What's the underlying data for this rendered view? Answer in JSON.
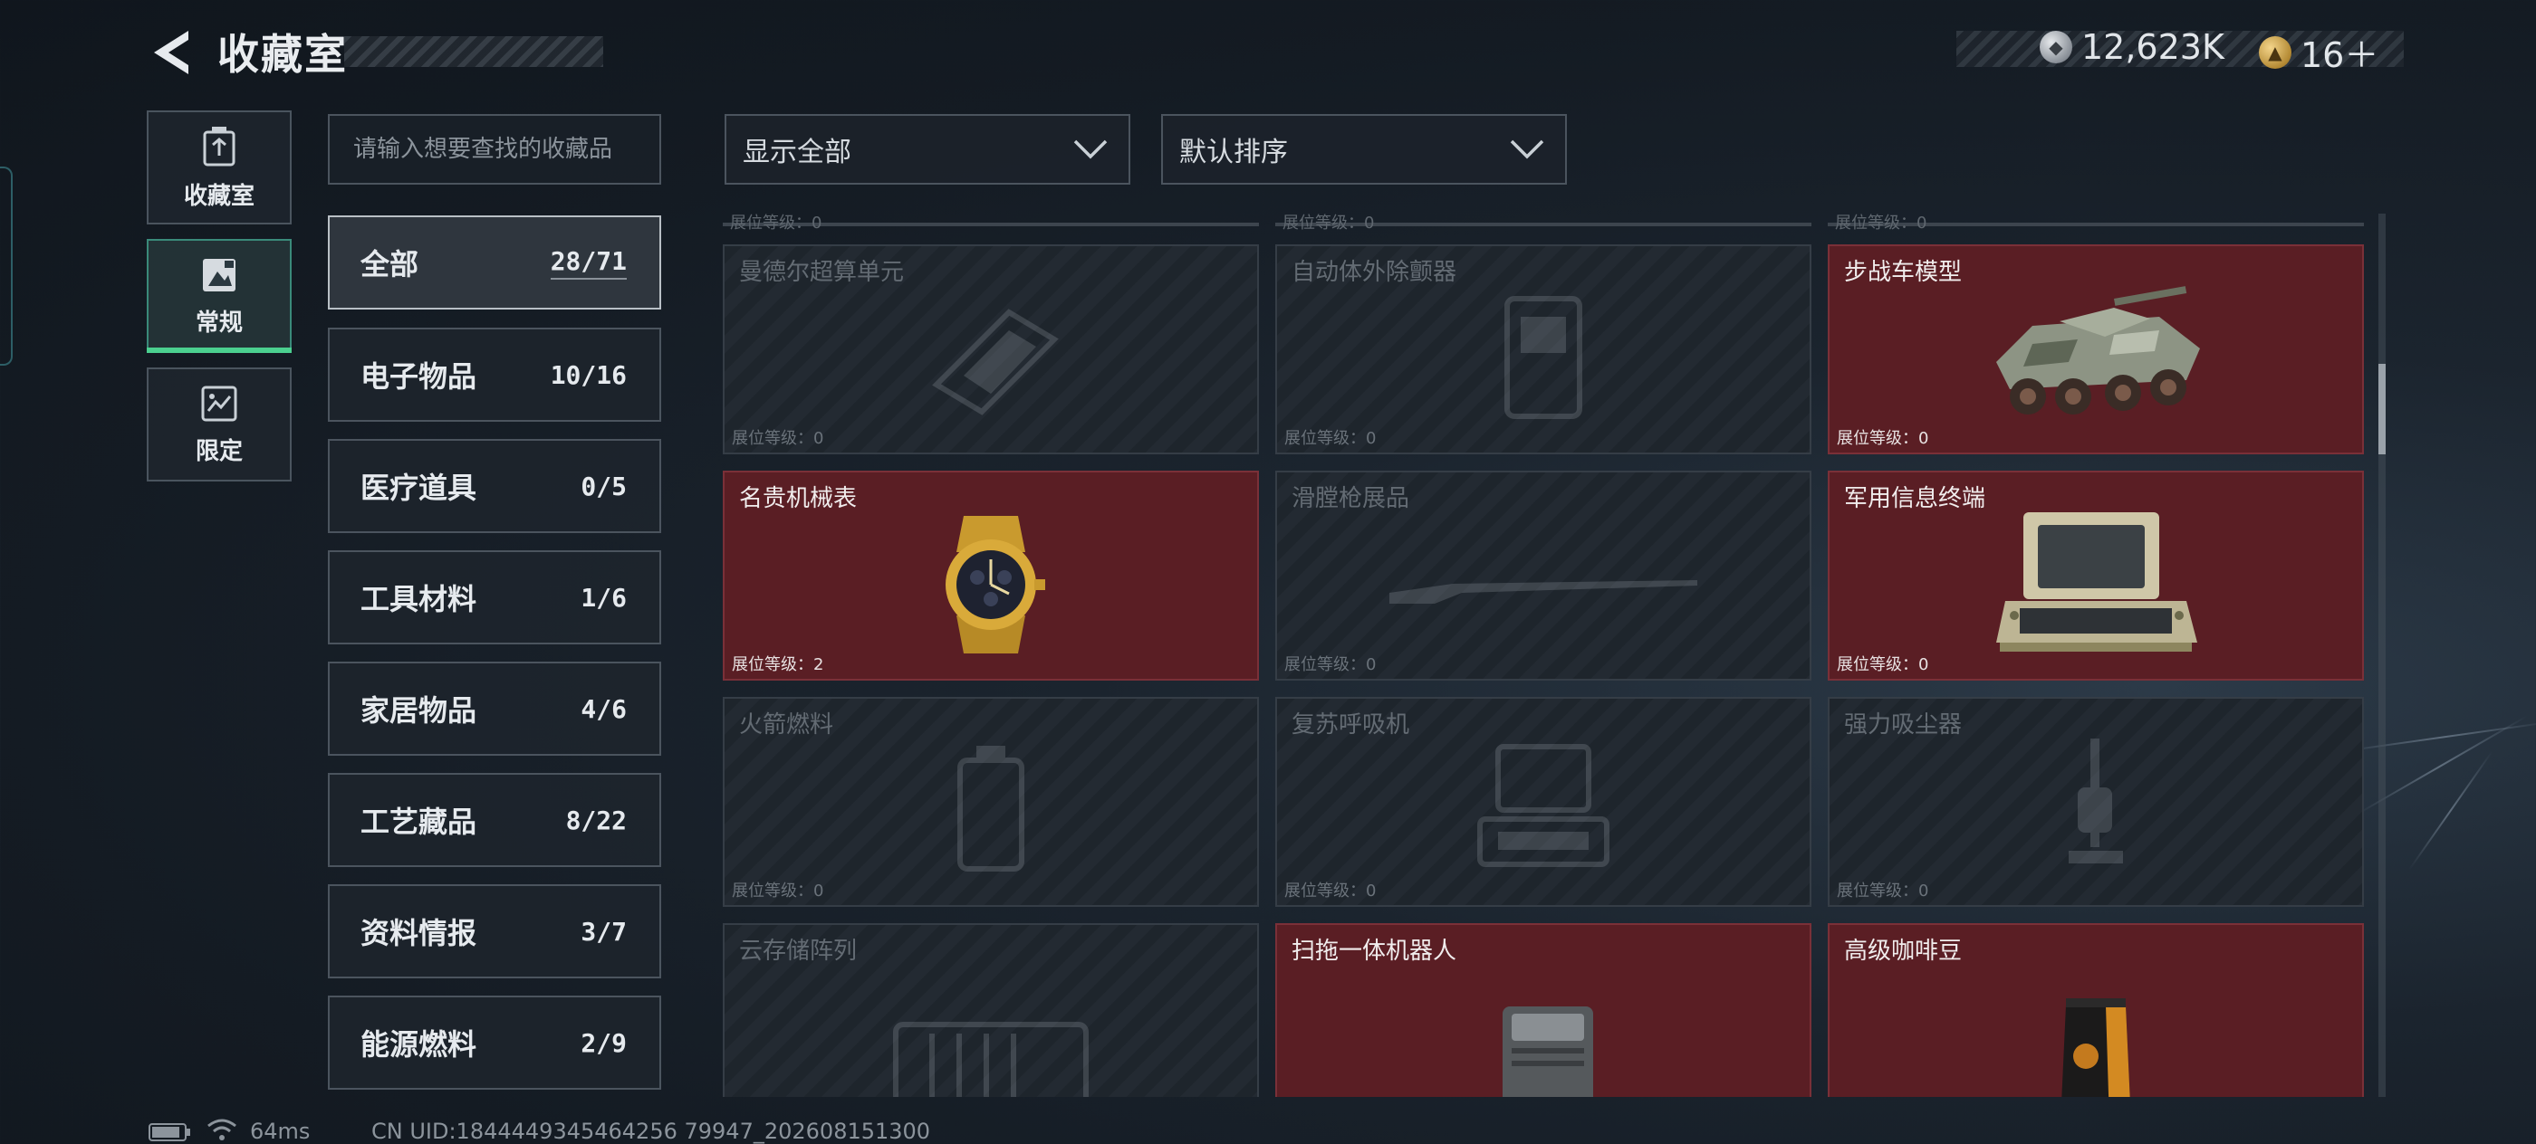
{
  "header": {
    "title": "收藏室"
  },
  "currency": {
    "silver": "12,623K",
    "gold": "16＋"
  },
  "nav": [
    {
      "label": "收藏室",
      "icon": "trash-bin-icon"
    },
    {
      "label": "常规",
      "icon": "display-case-icon"
    },
    {
      "label": "限定",
      "icon": "limited-badge-icon"
    }
  ],
  "search": {
    "placeholder": "请输入想要查找的收藏品",
    "value": ""
  },
  "filters": {
    "display": "显示全部",
    "sort": "默认排序"
  },
  "categories": [
    {
      "name": "全部",
      "count": "28/71"
    },
    {
      "name": "电子物品",
      "count": "10/16"
    },
    {
      "name": "医疗道具",
      "count": "0/5"
    },
    {
      "name": "工具材料",
      "count": "1/6"
    },
    {
      "name": "家居物品",
      "count": "4/6"
    },
    {
      "name": "工艺藏品",
      "count": "8/22"
    },
    {
      "name": "资料情报",
      "count": "3/7"
    },
    {
      "name": "能源燃料",
      "count": "2/9"
    }
  ],
  "partial_row": [
    "展位等级：0",
    "展位等级：0",
    "展位等级：0"
  ],
  "items": [
    {
      "name": "曼德尔超算单元",
      "level": "展位等级：0",
      "owned": false,
      "icon": "supercomputer-unit-icon"
    },
    {
      "name": "自动体外除颤器",
      "level": "展位等级：0",
      "owned": false,
      "icon": "defibrillator-icon"
    },
    {
      "name": "步战车模型",
      "level": "展位等级：0",
      "owned": true,
      "icon": "armored-vehicle-model-icon"
    },
    {
      "name": "名贵机械表",
      "level": "展位等级：2",
      "owned": true,
      "icon": "gold-watch-icon"
    },
    {
      "name": "滑膛枪展品",
      "level": "展位等级：0",
      "owned": false,
      "icon": "musket-icon"
    },
    {
      "name": "军用信息终端",
      "level": "展位等级：0",
      "owned": true,
      "icon": "military-terminal-icon"
    },
    {
      "name": "火箭燃料",
      "level": "展位等级：0",
      "owned": false,
      "icon": "rocket-fuel-icon"
    },
    {
      "name": "复苏呼吸机",
      "level": "展位等级：0",
      "owned": false,
      "icon": "ventilator-icon"
    },
    {
      "name": "强力吸尘器",
      "level": "展位等级：0",
      "owned": false,
      "icon": "vacuum-cleaner-icon"
    },
    {
      "name": "云存储阵列",
      "level": "",
      "owned": false,
      "icon": "storage-array-icon"
    },
    {
      "name": "扫拖一体机器人",
      "level": "",
      "owned": true,
      "icon": "mopping-robot-icon"
    },
    {
      "name": "高级咖啡豆",
      "level": "",
      "owned": true,
      "icon": "coffee-bag-icon"
    }
  ],
  "statusbar": {
    "ping": "64ms",
    "uid": "CN UID:1844449345464256 79947_202608151300"
  }
}
